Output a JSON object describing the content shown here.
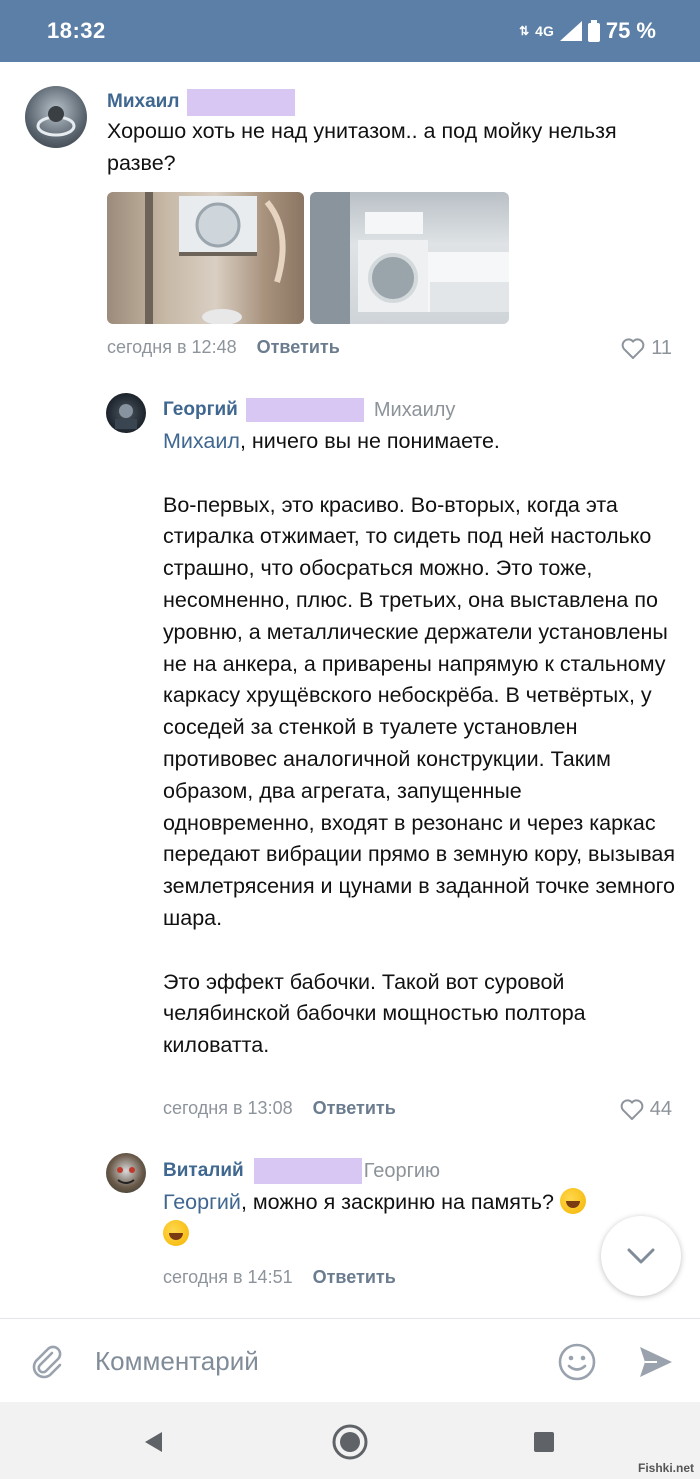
{
  "status_bar": {
    "time": "18:32",
    "network": "4G",
    "battery": "75 %"
  },
  "comments": [
    {
      "author": "Михаил",
      "text": "Хорошо хоть не над унитазом.. а под мойку нельзя разве?",
      "time": "сегодня в 12:48",
      "reply_label": "Ответить",
      "likes": "11"
    },
    {
      "author": "Георгий",
      "reply_to": "Михаилу",
      "mention": "Михаил",
      "text_first": ", ничего вы не понимаете.",
      "paragraph2": "Во-первых, это красиво. Во-вторых, когда эта стиралка отжимает, то сидеть под ней настолько страшно, что обосраться можно. Это тоже, несомненно, плюс. В третьих, она выставлена по уровню, а металлические держатели установлены не на анкера, а приварены напрямую к стальному каркасу хрущёвского небоскрёба. В четвёртых, у соседей за стенкой в туалете установлен противовес аналогичной конструкции. Таким образом, два агрегата, запущенные одновременно, входят в резонанс и через каркас передают вибрации прямо в земную кору, вызывая землетрясения и цунами в заданной точке земного шара.",
      "paragraph3": "Это эффект бабочки. Такой вот суровой челябинской бабочки мощностью полтора киловатта.",
      "time": "сегодня в 13:08",
      "reply_label": "Ответить",
      "likes": "44"
    },
    {
      "author": "Виталий",
      "reply_to": "Георгию",
      "mention": "Георгий",
      "text": ", можно я заскриню на память?",
      "time": "сегодня в 14:51",
      "reply_label": "Ответить"
    }
  ],
  "composer": {
    "placeholder": "Комментарий"
  },
  "watermark": "Fishki.net",
  "icons": {
    "attach": "paperclip-icon",
    "emoji": "smiley-icon",
    "send": "send-icon",
    "like": "heart-icon",
    "scroll": "chevron-down-icon",
    "nav_back": "back-triangle-icon",
    "nav_home": "home-circle-icon",
    "nav_recents": "recents-square-icon"
  },
  "colors": {
    "status_bar": "#5b7fa6",
    "link": "#3f6790",
    "redaction": "#d8c7f2",
    "meta": "#8d949b"
  }
}
